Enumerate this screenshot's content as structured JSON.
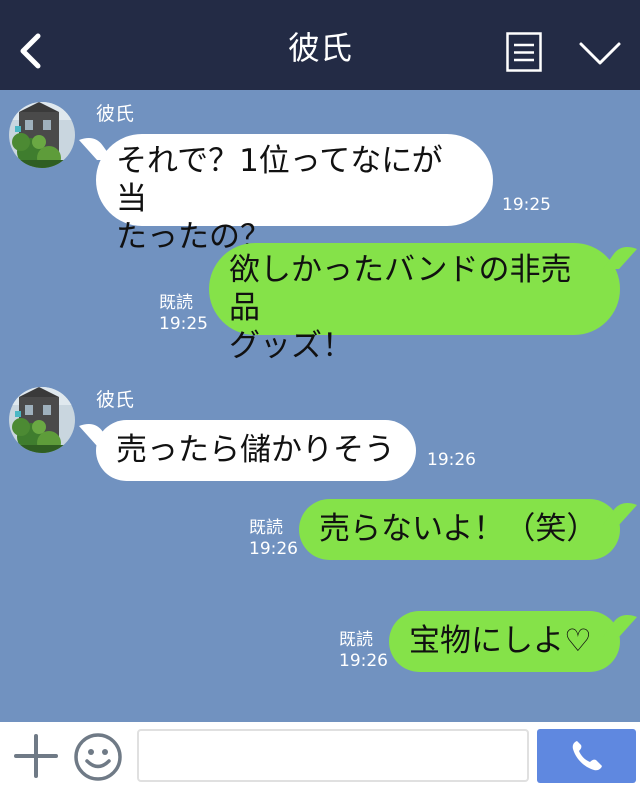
{
  "header": {
    "title": "彼氏",
    "back_icon": "chevron-left-icon",
    "menu_icon": "note-menu-icon",
    "dropdown_icon": "chevron-down-icon",
    "background": "#232b45"
  },
  "chat": {
    "background": "#7192c0",
    "messages": [
      {
        "direction": "incoming",
        "sender": "彼氏",
        "text": "それで？1位ってなにが当\nたったの？",
        "time": "19:25"
      },
      {
        "direction": "outgoing",
        "read_label": "既読",
        "text": "欲しかったバンドの非売品\nグッズ！",
        "time": "19:25"
      },
      {
        "direction": "incoming",
        "sender": "彼氏",
        "text": "売ったら儲かりそう",
        "time": "19:26"
      },
      {
        "direction": "outgoing",
        "read_label": "既読",
        "text": "売らないよ！（笑）",
        "time": "19:26"
      },
      {
        "direction": "outgoing",
        "read_label": "既読",
        "text": "宝物にしよ♡",
        "time": "19:26"
      }
    ]
  },
  "footer": {
    "plus_icon": "plus-icon",
    "emoji_icon": "smiley-icon",
    "input_value": "",
    "call_icon": "phone-icon",
    "call_button_color": "#5f88e0"
  },
  "colors": {
    "incoming_bubble": "#ffffff",
    "outgoing_bubble": "#85e249"
  }
}
